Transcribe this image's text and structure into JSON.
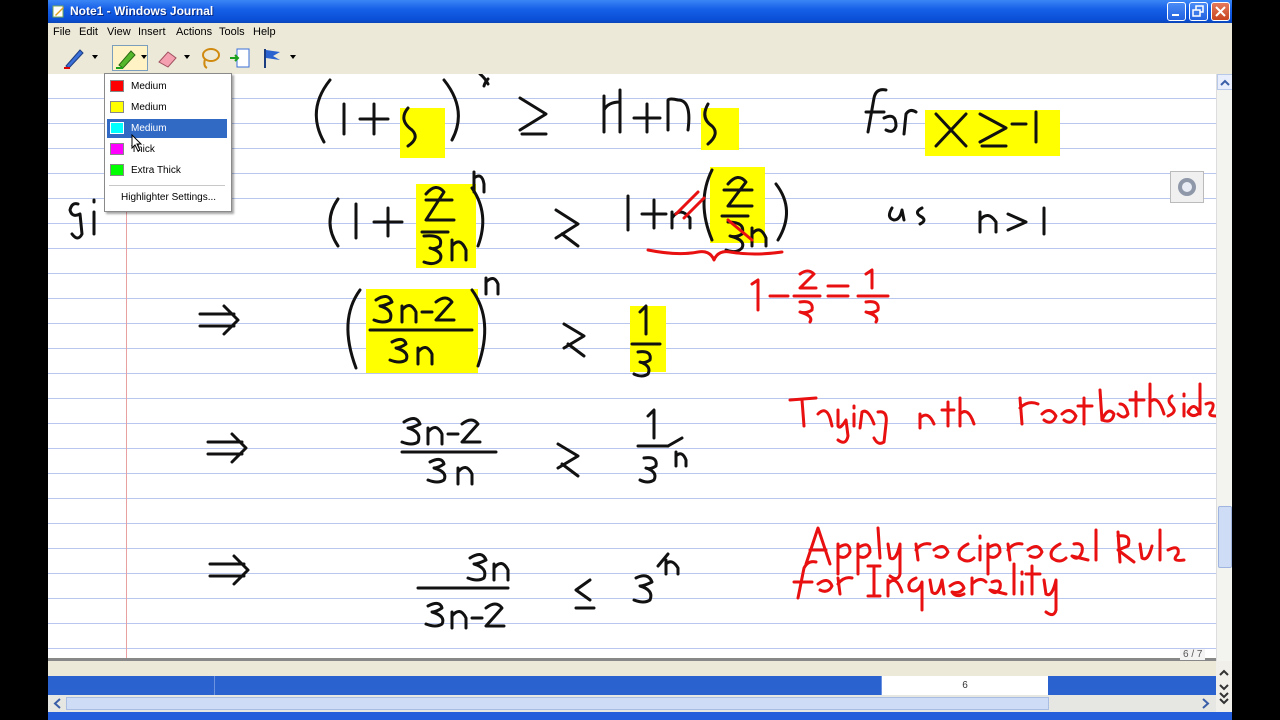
{
  "window": {
    "title": "Note1 - Windows Journal"
  },
  "menu": [
    "File",
    "Edit",
    "View",
    "Insert",
    "Actions",
    "Tools",
    "Help"
  ],
  "toolbar": {
    "tools": [
      {
        "icon": "pen-icon"
      },
      {
        "icon": "highlighter-icon",
        "active": true
      },
      {
        "icon": "eraser-icon"
      },
      {
        "icon": "lasso-select-icon"
      },
      {
        "icon": "insert-space-icon"
      },
      {
        "icon": "flag-icon"
      }
    ]
  },
  "highlighter_menu": {
    "items": [
      {
        "label": "Medium",
        "color": "#ff0000"
      },
      {
        "label": "Medium",
        "color": "#ffff00"
      },
      {
        "label": "Medium",
        "color": "#00ffff",
        "selected": true
      },
      {
        "label": "Thick",
        "color": "#ff00ff"
      },
      {
        "label": "Extra Thick",
        "color": "#00ff00"
      }
    ],
    "settings_label": "Highlighter Settings..."
  },
  "note": {
    "lines": [
      "(1+ x)^n ≥ 1+ nx   for x ≥ -1",
      "(1 + -2/3n)^n ≥ 1+ n(-2/3n)   as n > 1",
      "1 - 2/3 = 1/3",
      "⇒ ((3n-2)/3n)^n ≥ 1/3",
      "⇒ (3n-2)/3n ≥ 1/3^(1/n)   Taking nth root bothside",
      "⇒ 3n/(3n-2) ≤ 3^(1/n)   Apply reciprocal Rule for Inequality"
    ],
    "margin_text": "gi",
    "ink_colors": {
      "black": "#111111",
      "red": "#e81010",
      "highlight": "#ffff00"
    }
  },
  "page_counter": "6 / 7",
  "status": {
    "page_number": "6"
  }
}
